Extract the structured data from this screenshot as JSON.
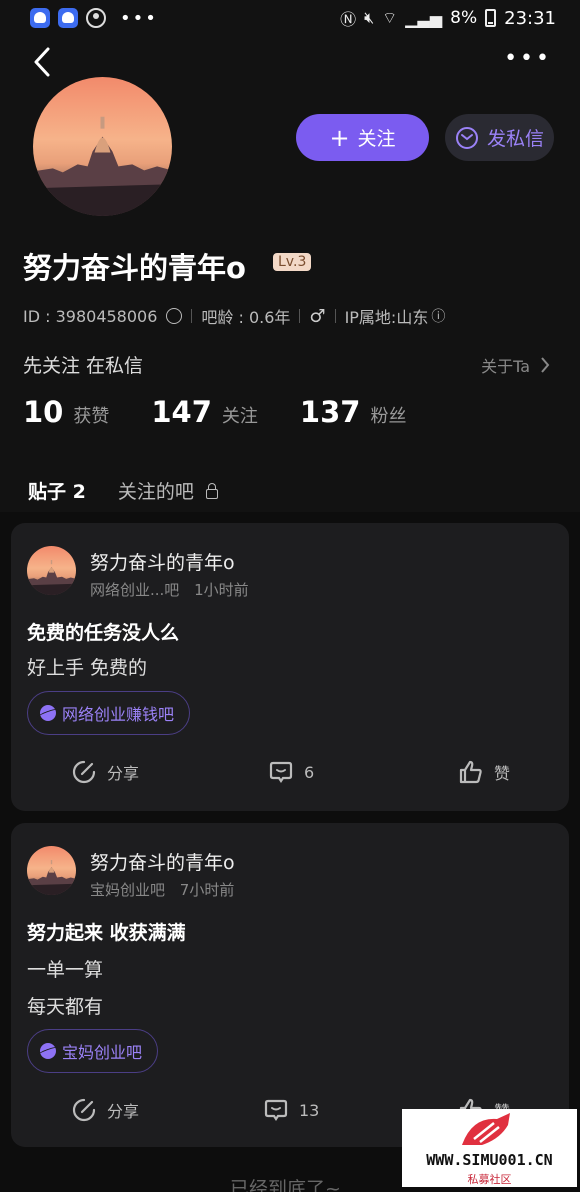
{
  "status_bar": {
    "battery": "8%",
    "time": "23:31"
  },
  "profile": {
    "name": "努力奋斗的青年o",
    "level": "Lv.3",
    "id_text": "ID : 3980458006",
    "bar_age": "吧龄 : 0.6年",
    "gender": "♂",
    "ip": "IP属地:山东",
    "signature": "先关注 在私信",
    "about_label": "关于Ta"
  },
  "buttons": {
    "follow": "关注",
    "message": "发私信"
  },
  "stats": [
    {
      "num": "10",
      "label": "获赞"
    },
    {
      "num": "147",
      "label": "关注"
    },
    {
      "num": "137",
      "label": "粉丝"
    }
  ],
  "tabs": {
    "posts": "贴子 2",
    "followed_bars": "关注的吧"
  },
  "posts": [
    {
      "author": "努力奋斗的青年o",
      "bar": "网络创业...吧",
      "time": "1小时前",
      "title": "免费的任务没人么",
      "lines": [
        "好上手 免费的"
      ],
      "chip": "网络创业赚钱吧",
      "share": "分享",
      "comments": "6",
      "like": "赞"
    },
    {
      "author": "努力奋斗的青年o",
      "bar": "宝妈创业吧",
      "time": "7小时前",
      "title": "努力起来 收获满满",
      "lines": [
        "一单一算",
        "每天都有"
      ],
      "chip": "宝妈创业吧",
      "share": "分享",
      "comments": "13",
      "like": "赞"
    }
  ],
  "footer": "已经到底了~",
  "watermark": {
    "url": "WWW.SIMU001.CN",
    "cn": "私募社区"
  },
  "colors": {
    "accent": "#7b5cf0",
    "background": "#121212",
    "card": "#1d1d1f"
  }
}
